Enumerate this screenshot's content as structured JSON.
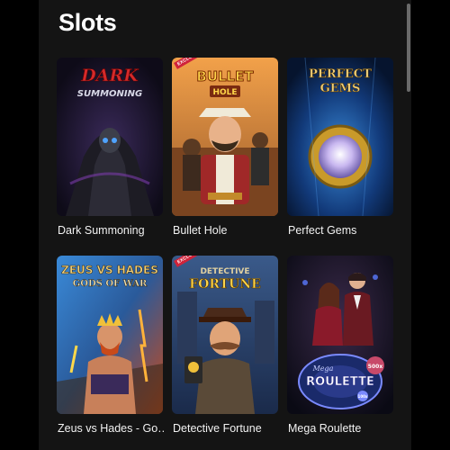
{
  "section": {
    "title": "Slots"
  },
  "games": [
    {
      "name": "Dark Summoning",
      "logo_line1": "DARK",
      "logo_line2": "SUMMONING"
    },
    {
      "name": "Bullet Hole",
      "logo_line1": "BULLET",
      "logo_line2": "HOLE",
      "badge": "EXCLUSIVE"
    },
    {
      "name": "Perfect Gems",
      "logo_line1": "PERFECT",
      "logo_line2": "GEMS"
    },
    {
      "name": "Zeus vs Hades - Go…",
      "logo_line1": "ZEUS VS HADES",
      "logo_line2": "GODS OF WAR"
    },
    {
      "name": "Detective Fortune",
      "logo_line1": "DETECTIVE",
      "logo_line2": "FORTUNE",
      "badge": "EXCLUSIVE"
    },
    {
      "name": "Mega Roulette",
      "logo_line1": "Mega",
      "logo_line2": "ROULETTE",
      "multiplier": "500x",
      "multiplier2": "100x"
    }
  ],
  "colors": {
    "background": "#141414",
    "badge": "#d0233a"
  }
}
